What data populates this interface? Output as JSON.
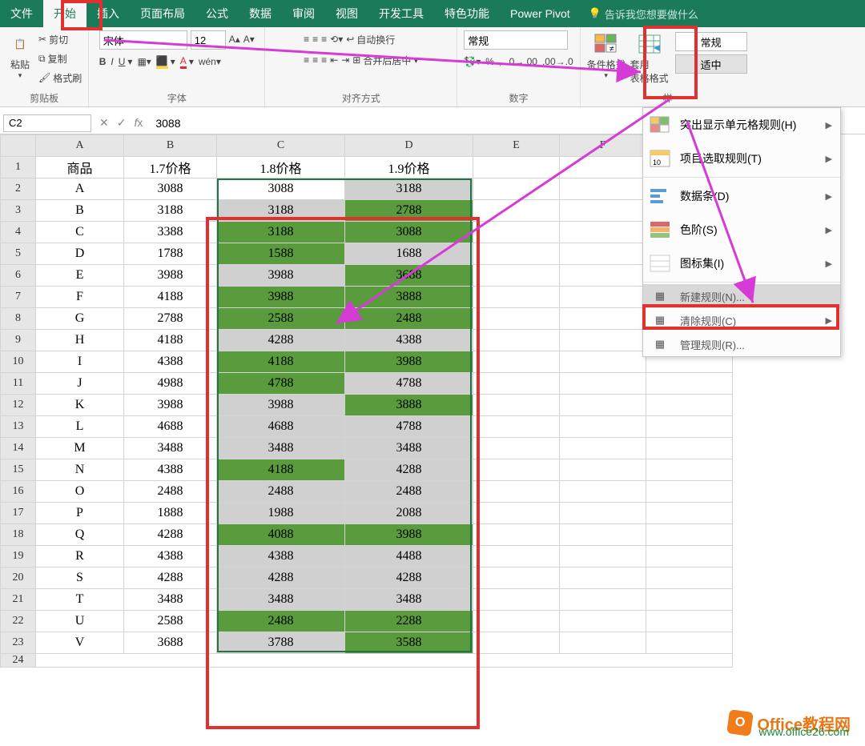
{
  "tabs": {
    "file": "文件",
    "home": "开始",
    "insert": "插入",
    "layout": "页面布局",
    "formulas": "公式",
    "data": "数据",
    "review": "审阅",
    "view": "视图",
    "dev": "开发工具",
    "special": "特色功能",
    "powerpivot": "Power Pivot",
    "tell": "告诉我您想要做什么"
  },
  "ribbon": {
    "clipboard": {
      "paste": "粘贴",
      "cut": "剪切",
      "copy": "复制",
      "format_painter": "格式刷",
      "label": "剪贴板"
    },
    "font": {
      "name": "宋体",
      "size": "12",
      "label": "字体"
    },
    "align": {
      "wrap": "自动换行",
      "merge": "合并后居中",
      "label": "对齐方式"
    },
    "number": {
      "format": "常规",
      "label": "数字"
    },
    "styles": {
      "cond": "条件格式",
      "table": "套用\n表格格式",
      "normal": "常规",
      "medium": "适中",
      "label": "样"
    }
  },
  "formula_bar": {
    "cell": "C2",
    "value": "3088"
  },
  "headers": {
    "A": "商品",
    "B": "1.7价格",
    "C": "1.8价格",
    "D": "1.9价格"
  },
  "rows": [
    {
      "p": "A",
      "b": "3088",
      "c": "3088",
      "d": "3188",
      "cc": "sel",
      "dc": "grey"
    },
    {
      "p": "B",
      "b": "3188",
      "c": "3188",
      "d": "2788",
      "cc": "grey",
      "dc": "green"
    },
    {
      "p": "C",
      "b": "3388",
      "c": "3188",
      "d": "3088",
      "cc": "green",
      "dc": "green"
    },
    {
      "p": "D",
      "b": "1788",
      "c": "1588",
      "d": "1688",
      "cc": "green",
      "dc": "grey"
    },
    {
      "p": "E",
      "b": "3988",
      "c": "3988",
      "d": "3688",
      "cc": "grey",
      "dc": "green"
    },
    {
      "p": "F",
      "b": "4188",
      "c": "3988",
      "d": "3888",
      "cc": "green",
      "dc": "green"
    },
    {
      "p": "G",
      "b": "2788",
      "c": "2588",
      "d": "2488",
      "cc": "green",
      "dc": "green"
    },
    {
      "p": "H",
      "b": "4188",
      "c": "4288",
      "d": "4388",
      "cc": "grey",
      "dc": "grey"
    },
    {
      "p": "I",
      "b": "4388",
      "c": "4188",
      "d": "3988",
      "cc": "green",
      "dc": "green"
    },
    {
      "p": "J",
      "b": "4988",
      "c": "4788",
      "d": "4788",
      "cc": "green",
      "dc": "grey"
    },
    {
      "p": "K",
      "b": "3988",
      "c": "3988",
      "d": "3888",
      "cc": "grey",
      "dc": "green"
    },
    {
      "p": "L",
      "b": "4688",
      "c": "4688",
      "d": "4788",
      "cc": "grey",
      "dc": "grey"
    },
    {
      "p": "M",
      "b": "3488",
      "c": "3488",
      "d": "3488",
      "cc": "grey",
      "dc": "grey"
    },
    {
      "p": "N",
      "b": "4388",
      "c": "4188",
      "d": "4288",
      "cc": "green",
      "dc": "grey"
    },
    {
      "p": "O",
      "b": "2488",
      "c": "2488",
      "d": "2488",
      "cc": "grey",
      "dc": "grey"
    },
    {
      "p": "P",
      "b": "1888",
      "c": "1988",
      "d": "2088",
      "cc": "grey",
      "dc": "grey"
    },
    {
      "p": "Q",
      "b": "4288",
      "c": "4088",
      "d": "3988",
      "cc": "green",
      "dc": "green"
    },
    {
      "p": "R",
      "b": "4388",
      "c": "4388",
      "d": "4488",
      "cc": "grey",
      "dc": "grey"
    },
    {
      "p": "S",
      "b": "4288",
      "c": "4288",
      "d": "4288",
      "cc": "grey",
      "dc": "grey"
    },
    {
      "p": "T",
      "b": "3488",
      "c": "3488",
      "d": "3488",
      "cc": "grey",
      "dc": "grey"
    },
    {
      "p": "U",
      "b": "2588",
      "c": "2488",
      "d": "2288",
      "cc": "green",
      "dc": "green"
    },
    {
      "p": "V",
      "b": "3688",
      "c": "3788",
      "d": "3588",
      "cc": "grey",
      "dc": "green"
    }
  ],
  "menu": {
    "highlight": "突出显示单元格规则(H)",
    "toprules": "项目选取规则(T)",
    "databars": "数据条(D)",
    "colorscales": "色阶(S)",
    "iconsets": "图标集(I)",
    "newrule": "新建规则(N)...",
    "clear": "清除规则(C)",
    "manage": "管理规则(R)..."
  },
  "watermark": {
    "title": "Office教程网",
    "url": "www.office26.com"
  }
}
